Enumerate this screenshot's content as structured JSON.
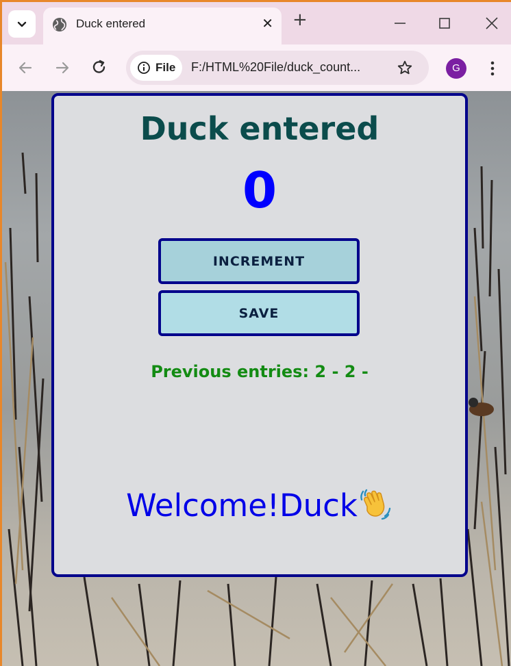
{
  "browser": {
    "tab_title": "Duck entered",
    "site_chip_label": "File",
    "url": "F:/HTML%20File/duck_count...",
    "profile_initial": "G",
    "profile_color": "#7b1fa2"
  },
  "card": {
    "title": "Duck entered",
    "count": "0",
    "increment_label": "INCREMENT",
    "save_label": "SAVE",
    "previous_entries": "Previous entries: 2 - 2 -",
    "welcome_text": "Welcome!Duck"
  },
  "colors": {
    "card_border": "#00008b",
    "title": "#0b4c4c",
    "counter": "#0000ff",
    "previous_entries": "#138b13",
    "welcome": "#0000e8"
  },
  "icons": {
    "welcome_emoji": "waving-hand-icon"
  }
}
